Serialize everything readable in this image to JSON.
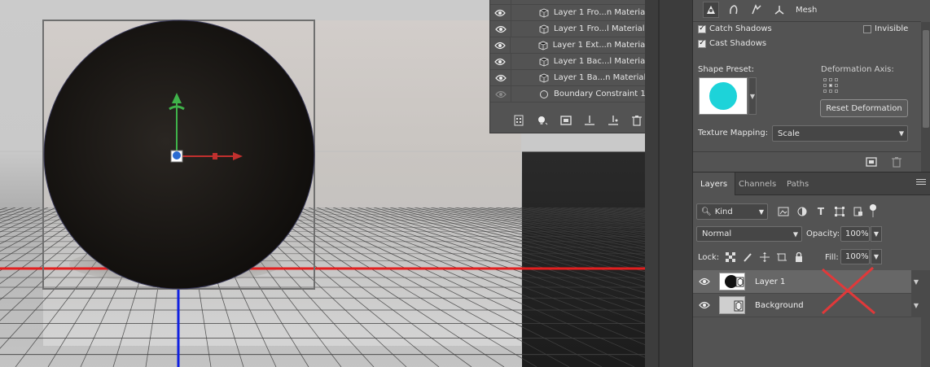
{
  "scene_panel": {
    "rows": [
      {
        "label": "Layer 1 Fro...n Material"
      },
      {
        "label": "Layer 1 Fro...l Material"
      },
      {
        "label": "Layer 1 Ext...n Material"
      },
      {
        "label": "Layer 1 Bac...l Material"
      },
      {
        "label": "Layer 1 Ba...n Material"
      },
      {
        "label": "Boundary Constraint 1"
      }
    ],
    "toolbar_icons": [
      "scene-icon",
      "light-bulb-icon",
      "add-mesh-icon",
      "ground-icon",
      "render-icon",
      "trash-icon"
    ]
  },
  "properties": {
    "mesh_label": "Mesh",
    "catch_shadows": {
      "label": "Catch Shadows",
      "checked": true
    },
    "cast_shadows": {
      "label": "Cast Shadows",
      "checked": true
    },
    "invisible": {
      "label": "Invisible",
      "checked": false
    },
    "shape_preset_label": "Shape Preset:",
    "shape_preset_color": "#1dd3d9",
    "deformation_axis_label": "Deformation Axis:",
    "reset_deformation_label": "Reset Deformation",
    "texture_mapping_label": "Texture Mapping:",
    "texture_mapping_value": "Scale"
  },
  "layers_panel": {
    "tabs": [
      {
        "label": "Layers",
        "active": true
      },
      {
        "label": "Channels",
        "active": false
      },
      {
        "label": "Paths",
        "active": false
      }
    ],
    "kind_filter": "Kind",
    "blend_mode": "Normal",
    "opacity_label": "Opacity:",
    "opacity_value": "100%",
    "lock_label": "Lock:",
    "fill_label": "Fill:",
    "fill_value": "100%",
    "layers": [
      {
        "name": "Layer 1",
        "selected": true,
        "visible": true
      },
      {
        "name": "Background",
        "selected": false,
        "visible": true
      }
    ]
  },
  "colors": {
    "panel_bg": "#535353",
    "sphere": "#17130f",
    "x_axis": "#e21f1f",
    "z_axis": "#1020e0",
    "gizmo_green": "#3fb24a",
    "annotation_red": "#e0393a"
  }
}
